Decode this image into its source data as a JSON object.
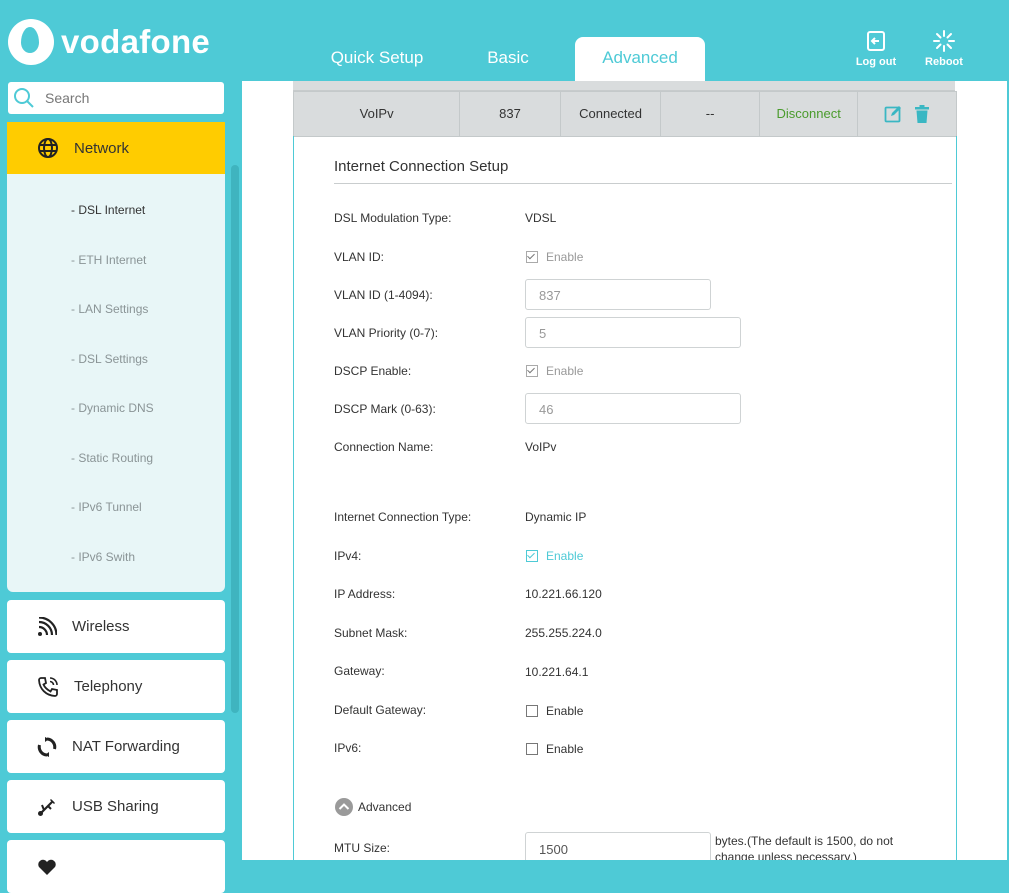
{
  "brand": {
    "name": "vodafone",
    "accent": "#4ecad6",
    "highlight": "#ffcc00"
  },
  "header": {
    "tabs": [
      {
        "label": "Quick Setup",
        "active": false
      },
      {
        "label": "Basic",
        "active": false
      },
      {
        "label": "Advanced",
        "active": true
      }
    ],
    "logout_label": "Log out",
    "reboot_label": "Reboot"
  },
  "sidebar": {
    "search_placeholder": "Search",
    "network": {
      "label": "Network",
      "items": [
        "- DSL Internet",
        "- ETH Internet",
        "- LAN Settings",
        "- DSL Settings",
        "- Dynamic DNS",
        "- Static Routing",
        "- IPv6 Tunnel",
        "- IPv6 Swith"
      ]
    },
    "items": [
      {
        "label": "Wireless",
        "icon": "wireless-icon"
      },
      {
        "label": "Telephony",
        "icon": "phone-icon"
      },
      {
        "label": "NAT Forwarding",
        "icon": "nat-icon"
      },
      {
        "label": "USB Sharing",
        "icon": "usb-icon"
      }
    ]
  },
  "connection_row": {
    "name": "VoIPv",
    "vlan": "837",
    "status": "Connected",
    "extra": "--",
    "action": "Disconnect"
  },
  "form": {
    "title": "Internet Connection Setup",
    "dsl_modulation_label": "DSL Modulation Type:",
    "dsl_modulation_value": "VDSL",
    "vlan_id_label": "VLAN ID:",
    "vlan_id_enable": "Enable",
    "vlan_id_range_label": "VLAN ID (1-4094):",
    "vlan_id_value": "837",
    "vlan_priority_label": "VLAN Priority (0-7):",
    "vlan_priority_value": "5",
    "dscp_enable_label": "DSCP Enable:",
    "dscp_enable_text": "Enable",
    "dscp_mark_label": "DSCP Mark (0-63):",
    "dscp_mark_value": "46",
    "connection_name_label": "Connection Name:",
    "connection_name_value": "VoIPv",
    "connection_type_label": "Internet Connection Type:",
    "connection_type_value": "Dynamic IP",
    "ipv4_label": "IPv4:",
    "ipv4_enable": "Enable",
    "ip_address_label": "IP Address:",
    "ip_address_value": "10.221.66.120",
    "subnet_label": "Subnet Mask:",
    "subnet_value": "255.255.224.0",
    "gateway_label": "Gateway:",
    "gateway_value": "10.221.64.1",
    "default_gateway_label": "Default Gateway:",
    "default_gateway_enable": "Enable",
    "ipv6_label": "IPv6:",
    "ipv6_enable": "Enable",
    "advanced_label": "Advanced",
    "mtu_label": "MTU Size:",
    "mtu_value": "1500",
    "mtu_note": "bytes.(The default is 1500, do not change unless necessary.)"
  }
}
